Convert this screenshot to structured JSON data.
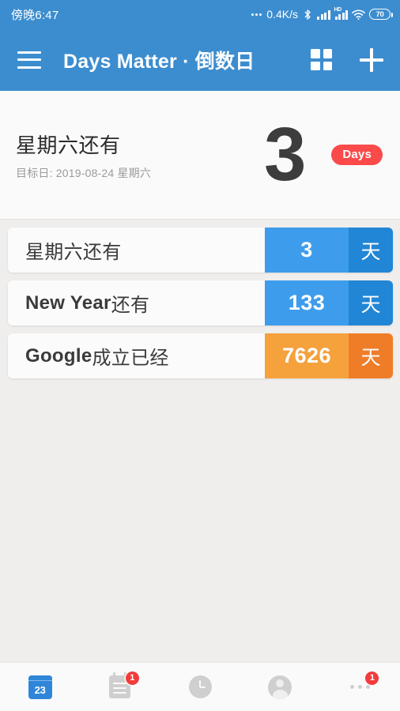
{
  "statusbar": {
    "time": "傍晚6:47",
    "netspeed": "0.4K/s",
    "hd_label": "HD",
    "battery_level": "70",
    "icons": [
      "dots-icon",
      "bluetooth-icon",
      "signal-icon",
      "hd-signal-icon",
      "wifi-icon",
      "battery-icon"
    ]
  },
  "appbar": {
    "menu_icon": "hamburger-menu-icon",
    "title": "Days Matter · 倒数日",
    "grid_icon": "grid-view-icon",
    "add_icon": "plus-icon"
  },
  "header_card": {
    "title": "星期六还有",
    "subtitle": "目标日: 2019-08-24 星期六",
    "count": "3",
    "badge": "Days",
    "badge_color": "#FB4A4A"
  },
  "list": {
    "items": [
      {
        "label_bold": "",
        "label_rest": "星期六还有",
        "count": "3",
        "unit": "天",
        "num_color": "#3E9CEC",
        "unit_color": "#2186D5"
      },
      {
        "label_bold": "New Year",
        "label_rest": " 还有",
        "count": "133",
        "unit": "天",
        "num_color": "#3E9CEC",
        "unit_color": "#2186D5"
      },
      {
        "label_bold": "Google",
        "label_rest": " 成立已经",
        "count": "7626",
        "unit": "天",
        "num_color": "#F5A13C",
        "unit_color": "#EF7D28"
      }
    ]
  },
  "bottomnav": {
    "items": [
      {
        "name": "calendar",
        "day": "23",
        "badge": "",
        "active": true
      },
      {
        "name": "list",
        "day": "",
        "badge": "1",
        "active": false
      },
      {
        "name": "clock",
        "day": "",
        "badge": "",
        "active": false
      },
      {
        "name": "profile",
        "day": "",
        "badge": "",
        "active": false
      },
      {
        "name": "more",
        "day": "",
        "badge": "1",
        "active": false
      }
    ]
  }
}
